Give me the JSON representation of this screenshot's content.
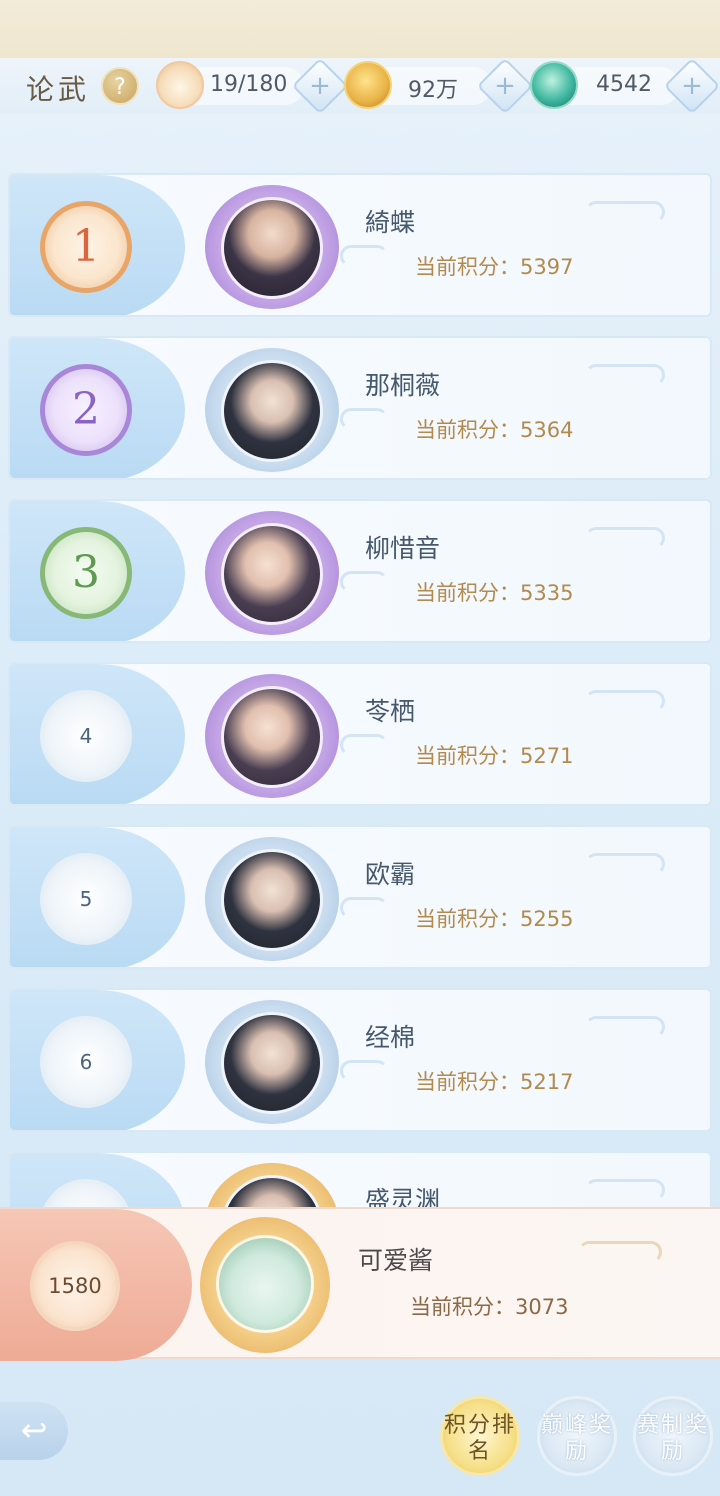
{
  "header": {
    "mode_title": "论武",
    "help_label": "?",
    "resources": [
      {
        "icon": "cat-icon",
        "value": "19/180"
      },
      {
        "icon": "coin-icon",
        "value": "92万"
      },
      {
        "icon": "jade-icon",
        "value": "4542"
      }
    ],
    "plus_label": "+"
  },
  "ranking": [
    {
      "rank": "1",
      "name": "綺蝶",
      "score_label": "当前积分：5397"
    },
    {
      "rank": "2",
      "name": "那桐薇",
      "score_label": "当前积分：5364"
    },
    {
      "rank": "3",
      "name": "柳惜音",
      "score_label": "当前积分：5335"
    },
    {
      "rank": "4",
      "name": "苓栖",
      "score_label": "当前积分：5271"
    },
    {
      "rank": "5",
      "name": "欧霸",
      "score_label": "当前积分：5255"
    },
    {
      "rank": "6",
      "name": "经棉",
      "score_label": "当前积分：5217"
    },
    {
      "rank": "",
      "name": "盛灵渊",
      "score_label": ""
    }
  ],
  "self": {
    "rank": "1580",
    "name": "可爱酱",
    "score_label": "当前积分：3073"
  },
  "bottom": {
    "back_icon": "back-arrow-icon",
    "back_label": "↩",
    "tabs": [
      {
        "label": "积分排名"
      },
      {
        "label": "巅峰奖励"
      },
      {
        "label": "赛制奖励"
      }
    ]
  }
}
